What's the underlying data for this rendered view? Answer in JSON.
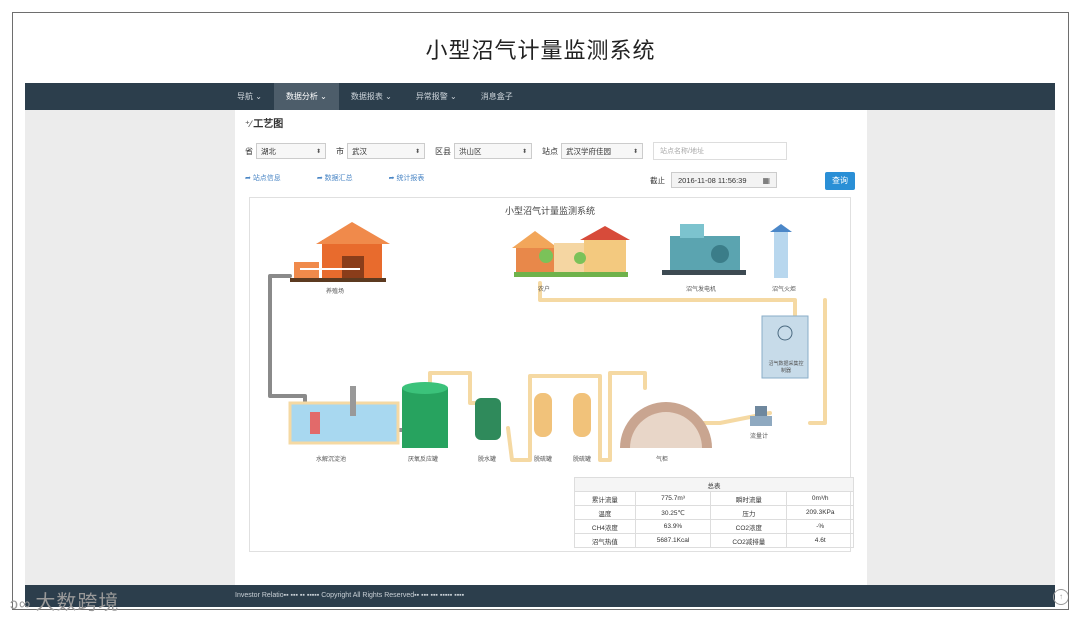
{
  "slide": {
    "title": "小型沼气计量监测系统"
  },
  "nav": {
    "items": [
      "导航 ⌄",
      "数据分析 ⌄",
      "数据报表 ⌄",
      "异常报警 ⌄",
      "消息盒子"
    ]
  },
  "section": {
    "title": "工艺图"
  },
  "filters": {
    "province_label": "省",
    "province_value": "湖北",
    "city_label": "市",
    "city_value": "武汉",
    "district_label": "区县",
    "district_value": "洪山区",
    "site_label": "站点",
    "site_value": "武汉学府佳园",
    "search_placeholder": "站点名称/地址"
  },
  "links": [
    "站点信息",
    "数据汇总",
    "统计报表"
  ],
  "deadline": {
    "label": "截止",
    "value": "2016-11-08 11:56:39",
    "button": "查询"
  },
  "diagram": {
    "title": "小型沼气计量监测系统",
    "labels": {
      "farm": "养殖场",
      "household": "农户",
      "generator": "沼气发电机",
      "torch": "沼气火炬",
      "controller": "沼气数据采集控制器",
      "flowmeter": "流量计",
      "tank1": "水解沉淀池",
      "reactor": "厌氧反应罐",
      "dewater": "脱水罐",
      "desulf1": "脱硫罐",
      "desulf2": "脱硫罐",
      "holder": "气柜"
    }
  },
  "summary": {
    "title": "总表",
    "rows": [
      [
        "累计流量",
        "775.7m³",
        "瞬时流量",
        "0m³/h"
      ],
      [
        "温度",
        "30.25℃",
        "压力",
        "209.3KPa"
      ],
      [
        "CH4浓度",
        "63.9%",
        "CO2浓度",
        "-%"
      ],
      [
        "沼气热值",
        "5687.1Kcal",
        "CO2减排量",
        "4.6t"
      ]
    ]
  },
  "footer": {
    "text": "Investor Relatio▪▪ ▪▪▪ ▪▪ ▪▪▪▪▪ Copyright All Rights Reserved▪▪   ▪▪▪ ▪▪▪   ▪▪▪▪▪ ▪▪▪▪"
  },
  "watermark": {
    "text": "大数跨境"
  },
  "colors": {
    "navbar": "#2c3e4c",
    "pipe": "#f5d9a3",
    "accent": "#2a8fd6"
  }
}
